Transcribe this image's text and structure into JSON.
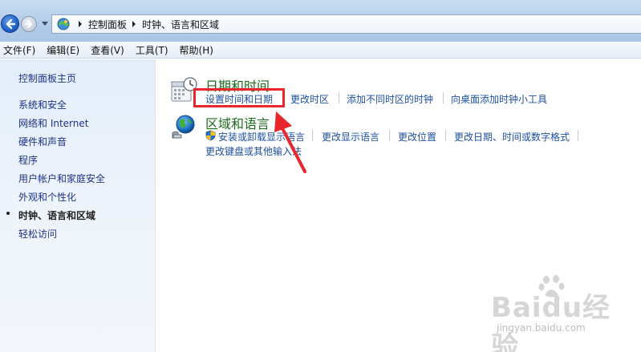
{
  "address_bar": {
    "crumbs": [
      "控制面板",
      "时钟、语言和区域"
    ]
  },
  "menu": [
    "文件(F)",
    "编辑(E)",
    "查看(V)",
    "工具(T)",
    "帮助(H)"
  ],
  "sidebar": {
    "home": "控制面板主页",
    "items": [
      "系统和安全",
      "网络和 Internet",
      "硬件和声音",
      "程序",
      "用户帐户和家庭安全",
      "外观和个性化",
      "时钟、语言和区域",
      "轻松访问"
    ]
  },
  "main": {
    "date_time": {
      "title": "日期和时间",
      "links": [
        "设置时间和日期",
        "更改时区",
        "添加不同时区的时钟",
        "向桌面添加时钟小工具"
      ]
    },
    "region_language": {
      "title": "区域和语言",
      "links": [
        "安装或卸载显示语言",
        "更改显示语言",
        "更改位置",
        "更改日期、时间或数字格式",
        "更改键盘或其他输入法"
      ]
    }
  },
  "annotation": {
    "color": "#e8262b"
  },
  "watermark": {
    "main": "Baidu经验",
    "sub": "jingyan.baidu.com"
  }
}
